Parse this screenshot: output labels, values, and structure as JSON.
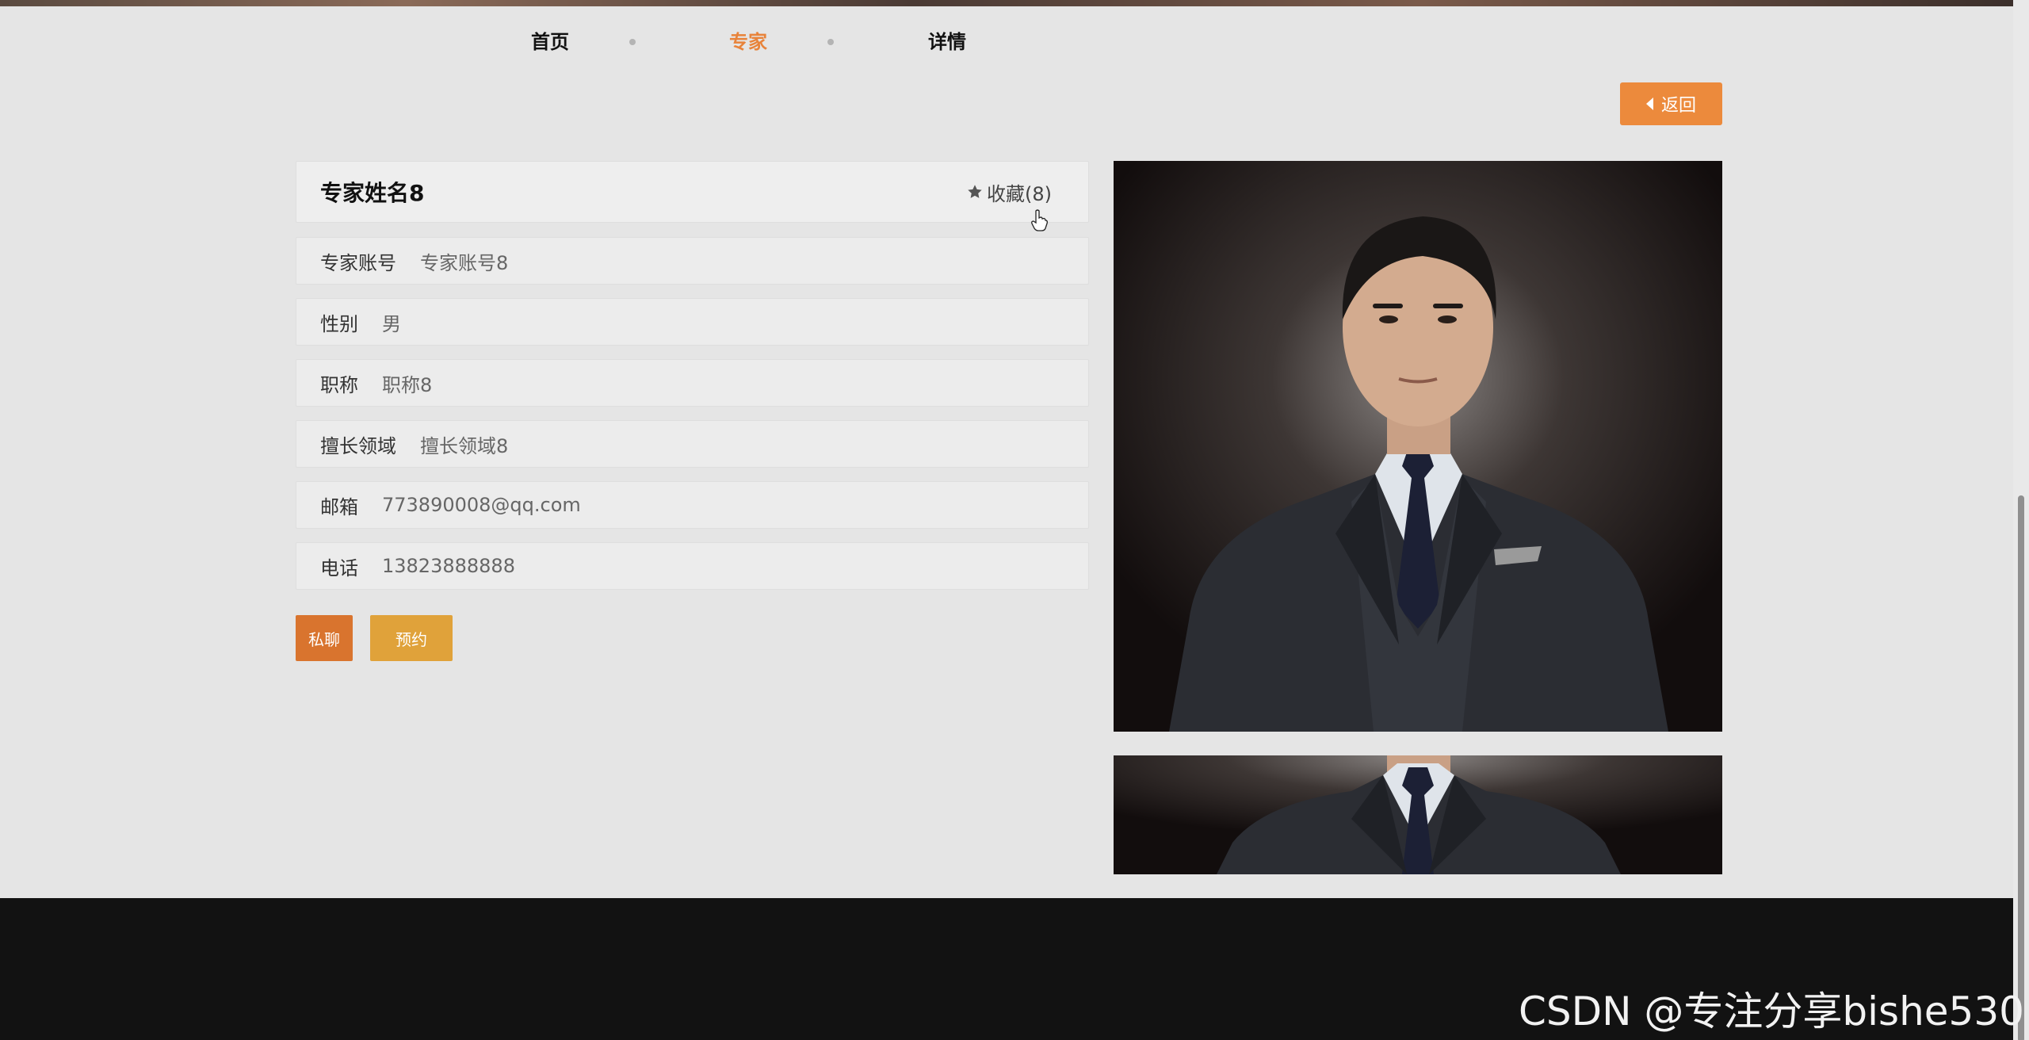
{
  "breadcrumb": {
    "home": "首页",
    "experts": "专家",
    "details": "详情"
  },
  "back_button": {
    "label": "返回",
    "icon": "caret-left-icon"
  },
  "expert": {
    "name": "专家姓名8",
    "favorite_label": "收藏(8)",
    "favorite_icon": "star-icon",
    "fields": [
      {
        "label": "专家账号",
        "value": "专家账号8"
      },
      {
        "label": "性别",
        "value": "男"
      },
      {
        "label": "职称",
        "value": "职称8"
      },
      {
        "label": "擅长领域",
        "value": "擅长领域8"
      },
      {
        "label": "邮箱",
        "value": "773890008@qq.com"
      },
      {
        "label": "电话",
        "value": "13823888888"
      }
    ]
  },
  "actions": {
    "chat_label": "私聊",
    "book_label": "预约"
  },
  "colors": {
    "accent_orange": "#ec8a3c",
    "chat_button": "#d9742e",
    "book_button": "#e0a23a",
    "footer": "#121212"
  },
  "watermark": "CSDN @专注分享bishe530"
}
